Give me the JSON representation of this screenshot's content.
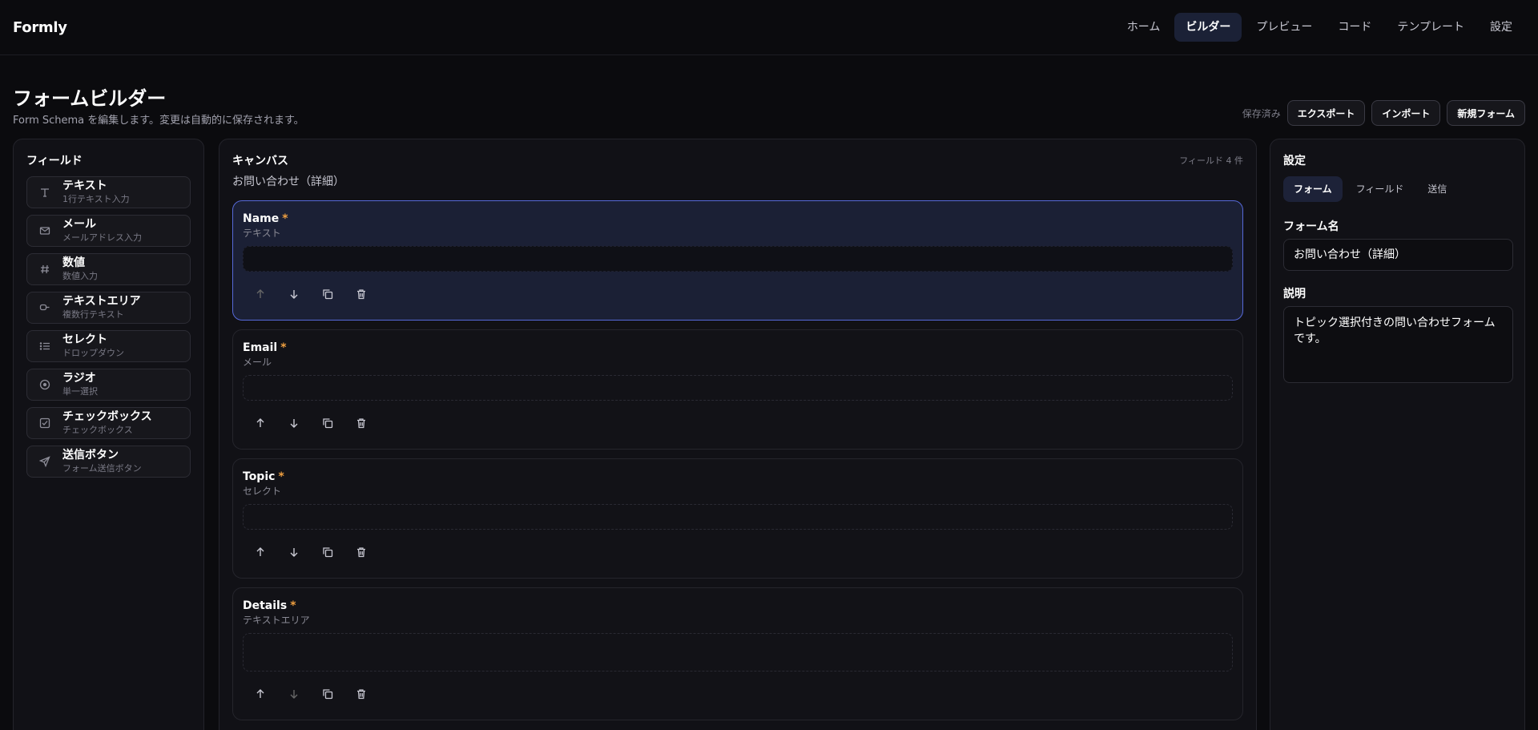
{
  "app": {
    "brand": "Formly"
  },
  "nav": {
    "items": [
      {
        "label": "ホーム",
        "active": false
      },
      {
        "label": "ビルダー",
        "active": true
      },
      {
        "label": "プレビュー",
        "active": false
      },
      {
        "label": "コード",
        "active": false
      },
      {
        "label": "テンプレート",
        "active": false
      },
      {
        "label": "設定",
        "active": false
      }
    ]
  },
  "header": {
    "title": "フォームビルダー",
    "subtitle": "Form Schema を編集します。変更は自動的に保存されます。",
    "saved_status": "保存済み",
    "export_label": "エクスポート",
    "import_label": "インポート",
    "new_form_label": "新規フォーム"
  },
  "palette": {
    "title": "フィールド",
    "items": [
      {
        "label": "テキスト",
        "sub": "1行テキスト入力",
        "icon": "text-icon"
      },
      {
        "label": "メール",
        "sub": "メールアドレス入力",
        "icon": "mail-icon"
      },
      {
        "label": "数値",
        "sub": "数値入力",
        "icon": "hash-icon"
      },
      {
        "label": "テキストエリア",
        "sub": "複数行テキスト",
        "icon": "paragraph-icon"
      },
      {
        "label": "セレクト",
        "sub": "ドロップダウン",
        "icon": "list-icon"
      },
      {
        "label": "ラジオ",
        "sub": "単一選択",
        "icon": "radio-icon"
      },
      {
        "label": "チェックボックス",
        "sub": "チェックボックス",
        "icon": "checkbox-icon"
      },
      {
        "label": "送信ボタン",
        "sub": "フォーム送信ボタン",
        "icon": "send-icon"
      }
    ]
  },
  "canvas": {
    "title": "キャンバス",
    "form_name": "お問い合わせ（詳細）",
    "field_count": "フィールド 4 件",
    "fields": [
      {
        "label": "Name",
        "required_mark": "*",
        "type": "テキスト",
        "selected": true
      },
      {
        "label": "Email",
        "required_mark": "*",
        "type": "メール",
        "selected": false
      },
      {
        "label": "Topic",
        "required_mark": "*",
        "type": "セレクト",
        "selected": false
      },
      {
        "label": "Details",
        "required_mark": "*",
        "type": "テキストエリア",
        "selected": false
      }
    ]
  },
  "settings": {
    "title": "設定",
    "tabs": [
      {
        "label": "フォーム",
        "active": true
      },
      {
        "label": "フィールド",
        "active": false
      },
      {
        "label": "送信",
        "active": false
      }
    ],
    "form_name_label": "フォーム名",
    "form_name_value": "お問い合わせ（詳細）",
    "description_label": "説明",
    "description_value": "トピック選択付きの問い合わせフォームです。"
  },
  "colors": {
    "background": "#0b0b0e",
    "accent": "#5669d8",
    "required": "#f0a040"
  }
}
